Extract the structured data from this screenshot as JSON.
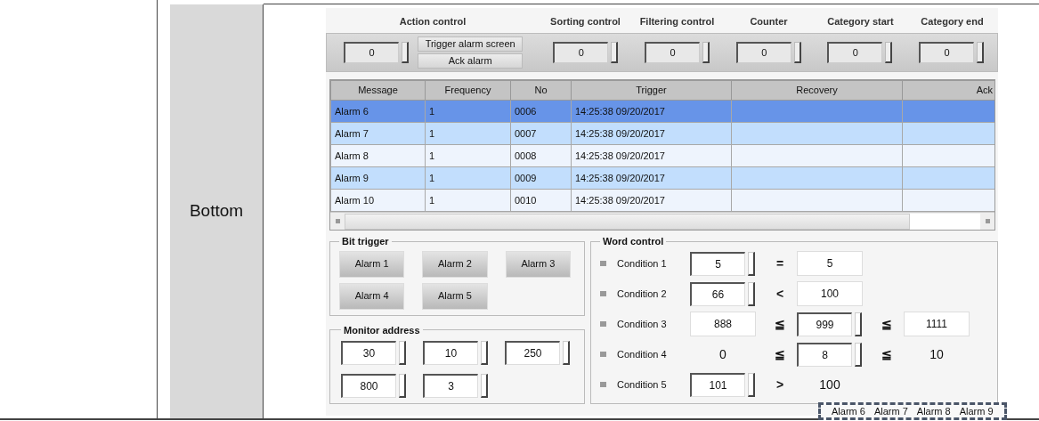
{
  "doc_table": {
    "row_label": "Bottom"
  },
  "top_controls": [
    {
      "label": "Action control",
      "value": "0",
      "buttons": [
        "Trigger alarm screen",
        "Ack alarm"
      ]
    },
    {
      "label": "Sorting control",
      "value": "0"
    },
    {
      "label": "Filtering control",
      "value": "0"
    },
    {
      "label": "Counter",
      "value": "0"
    },
    {
      "label": "Category start",
      "value": "0"
    },
    {
      "label": "Category end",
      "value": "0"
    }
  ],
  "alarm_table": {
    "columns": [
      "Message",
      "Frequency",
      "No",
      "Trigger",
      "Recovery",
      "Ack"
    ],
    "rows": [
      {
        "cells": [
          "Alarm 6",
          "1",
          "0006",
          "14:25:38 09/20/2017",
          "",
          ""
        ],
        "selected": true
      },
      {
        "cells": [
          "Alarm 7",
          "1",
          "0007",
          "14:25:38 09/20/2017",
          "",
          ""
        ],
        "selected": false
      },
      {
        "cells": [
          "Alarm 8",
          "1",
          "0008",
          "14:25:38 09/20/2017",
          "",
          ""
        ],
        "selected": false
      },
      {
        "cells": [
          "Alarm 9",
          "1",
          "0009",
          "14:25:38 09/20/2017",
          "",
          ""
        ],
        "selected": false
      },
      {
        "cells": [
          "Alarm 10",
          "1",
          "0010",
          "14:25:38 09/20/2017",
          "",
          ""
        ],
        "selected": false
      }
    ]
  },
  "bit_trigger": {
    "title": "Bit trigger",
    "buttons": [
      "Alarm 1",
      "Alarm 2",
      "Alarm 3",
      "Alarm 4",
      "Alarm 5"
    ]
  },
  "monitor_address": {
    "title": "Monitor address",
    "values": [
      "30",
      "10",
      "250",
      "800",
      "3"
    ]
  },
  "word_control": {
    "title": "Word control",
    "conditions": [
      {
        "label": "Condition 1",
        "operands": [
          {
            "kind": "spin",
            "value": "5"
          },
          {
            "kind": "box",
            "value": "5"
          }
        ],
        "operators": [
          "="
        ]
      },
      {
        "label": "Condition 2",
        "operands": [
          {
            "kind": "spin",
            "value": "66"
          },
          {
            "kind": "box",
            "value": "100"
          }
        ],
        "operators": [
          "<"
        ]
      },
      {
        "label": "Condition 3",
        "operands": [
          {
            "kind": "box",
            "value": "888"
          },
          {
            "kind": "spin",
            "value": "999"
          },
          {
            "kind": "box",
            "value": "1111"
          }
        ],
        "operators": [
          "≦",
          "≦"
        ]
      },
      {
        "label": "Condition 4",
        "operands": [
          {
            "kind": "text",
            "value": "0"
          },
          {
            "kind": "spin",
            "value": "8"
          },
          {
            "kind": "text",
            "value": "10"
          }
        ],
        "operators": [
          "≦",
          "≦"
        ]
      },
      {
        "label": "Condition 5",
        "operands": [
          {
            "kind": "spin",
            "value": "101"
          },
          {
            "kind": "text",
            "value": "100"
          }
        ],
        "operators": [
          ">"
        ]
      }
    ]
  },
  "alarm_marquee": [
    "Alarm 6",
    "Alarm 7",
    "Alarm 8",
    "Alarm 9"
  ]
}
